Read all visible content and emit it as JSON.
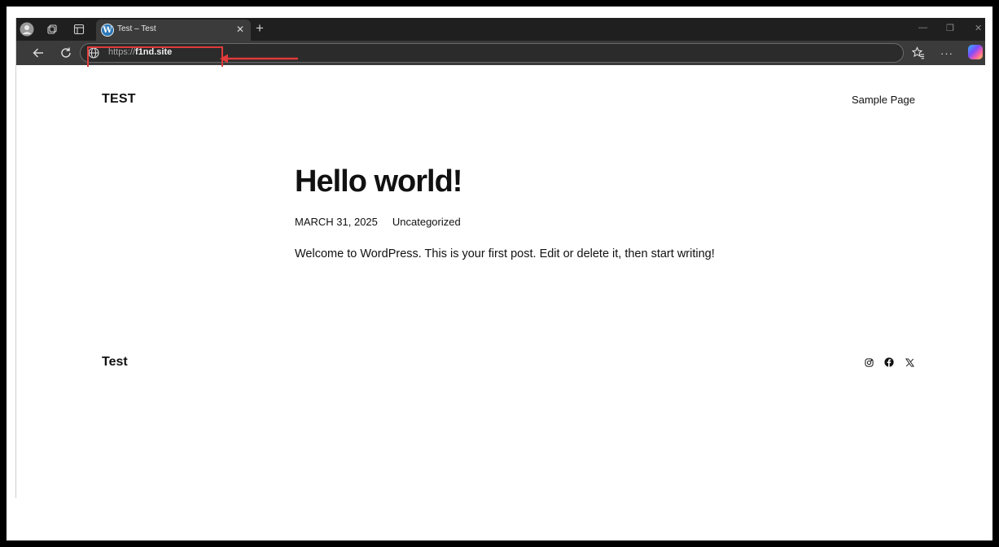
{
  "browser": {
    "tab": {
      "title": "Test – Test",
      "favicon": "wordpress-icon",
      "close": "✕"
    },
    "new_tab": "+",
    "window_controls": {
      "minimize": "—",
      "restore": "❐",
      "close": "✕"
    },
    "address": {
      "scheme": "https://",
      "host": "f1nd.site",
      "icon": "globe-icon"
    },
    "toolbar_icons": [
      "back-icon",
      "refresh-icon",
      "favorites-icon",
      "more-icon",
      "copilot-icon"
    ],
    "more_label": "···"
  },
  "annotation": {
    "color": "#e03a3a"
  },
  "site": {
    "title": "TEST",
    "nav": [
      "Sample Page"
    ]
  },
  "post": {
    "title": "Hello world!",
    "date": "MARCH 31, 2025",
    "category": "Uncategorized",
    "body": "Welcome to WordPress. This is your first post. Edit or delete it, then start writing!"
  },
  "footer": {
    "title": "Test",
    "social_icons": [
      "instagram-icon",
      "facebook-icon",
      "x-icon"
    ]
  }
}
